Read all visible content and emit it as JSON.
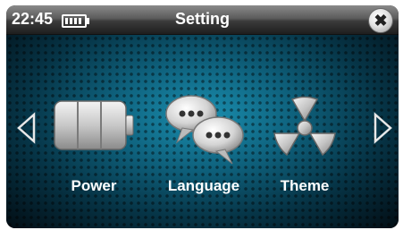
{
  "status_bar": {
    "time": "22:45",
    "battery_icon": "battery-full-icon"
  },
  "header": {
    "title": "Setting",
    "close_icon": "close-icon"
  },
  "carousel": {
    "prev_icon": "left-arrow-icon",
    "next_icon": "right-arrow-icon",
    "items": [
      {
        "label": "Power",
        "icon": "battery-icon"
      },
      {
        "label": "Language",
        "icon": "speech-bubbles-icon"
      },
      {
        "label": "Theme",
        "icon": "radiation-symbol-icon"
      }
    ]
  },
  "colors": {
    "background_accent": "#1a8fb0",
    "title_bar": "#3b3b3b",
    "text": "#ffffff"
  }
}
